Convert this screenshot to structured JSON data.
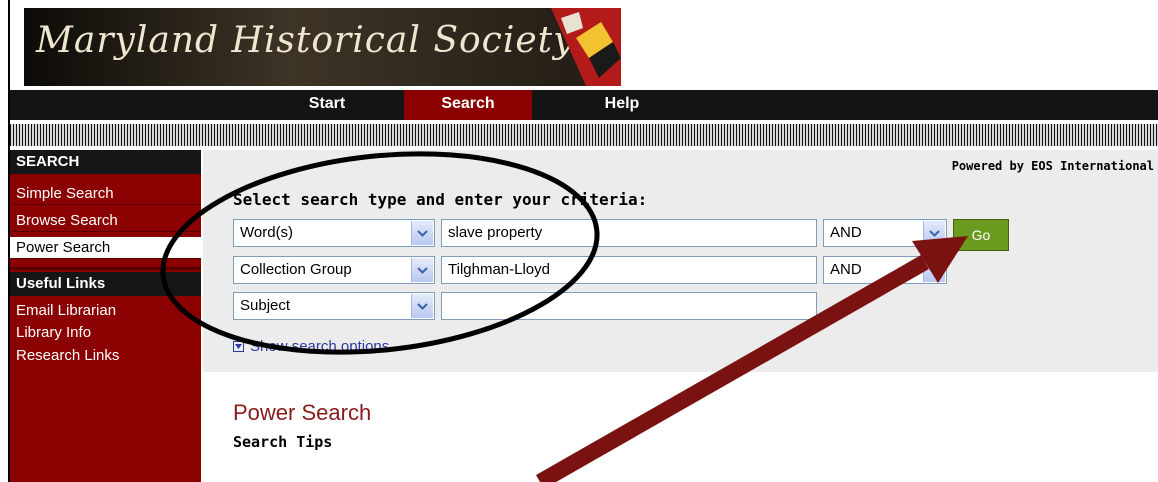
{
  "logo": {
    "text": "Maryland Historical Society"
  },
  "nav": {
    "tabs": [
      {
        "label": "Start"
      },
      {
        "label": "Search"
      },
      {
        "label": "Help"
      }
    ]
  },
  "sidebar": {
    "search_header": "SEARCH",
    "items": [
      {
        "label": "Simple Search"
      },
      {
        "label": "Browse Search"
      },
      {
        "label": "Power Search"
      }
    ],
    "links_header": "Useful Links",
    "links": [
      {
        "label": "Email Librarian"
      },
      {
        "label": "Library Info"
      },
      {
        "label": "Research Links"
      }
    ]
  },
  "search": {
    "powered_by": "Powered by EOS International",
    "title": "Select search type and enter your criteria:",
    "rows": [
      {
        "type": "Word(s)",
        "value": "slave property",
        "operator": "AND"
      },
      {
        "type": "Collection Group",
        "value": "Tilghman-Lloyd",
        "operator": "AND"
      },
      {
        "type": "Subject",
        "value": ""
      }
    ],
    "go_label": "Go",
    "show_options": "Show search options"
  },
  "content": {
    "heading": "Power Search",
    "subheading": "Search Tips"
  },
  "colors": {
    "accent": "#8b0000",
    "nav_bg": "#141414",
    "go_button": "#6a9a1e",
    "panel_bg": "#ececec",
    "annotation": "#7a1212"
  }
}
